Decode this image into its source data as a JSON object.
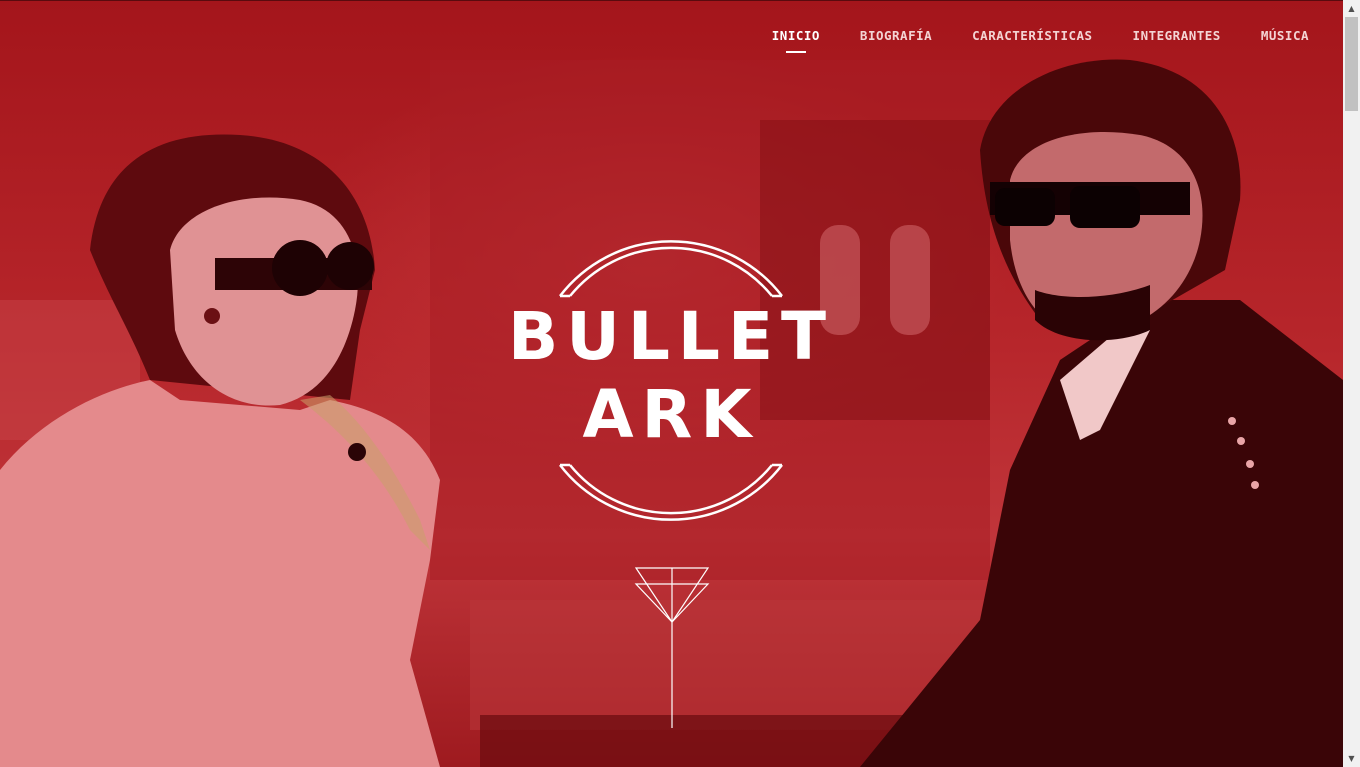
{
  "nav": {
    "items": [
      {
        "label": "INICIO",
        "active": true
      },
      {
        "label": "BIOGRAFÍA",
        "active": false
      },
      {
        "label": "CARACTERÍSTICAS",
        "active": false
      },
      {
        "label": "INTEGRANTES",
        "active": false
      },
      {
        "label": "MÚSICA",
        "active": false
      }
    ]
  },
  "logo": {
    "line1": "BULLET",
    "line2": "ARK"
  },
  "colors": {
    "overlay": "#b7262b",
    "text": "#ffffff"
  },
  "icons": {
    "scroll": "arrow-triangle-icon"
  }
}
